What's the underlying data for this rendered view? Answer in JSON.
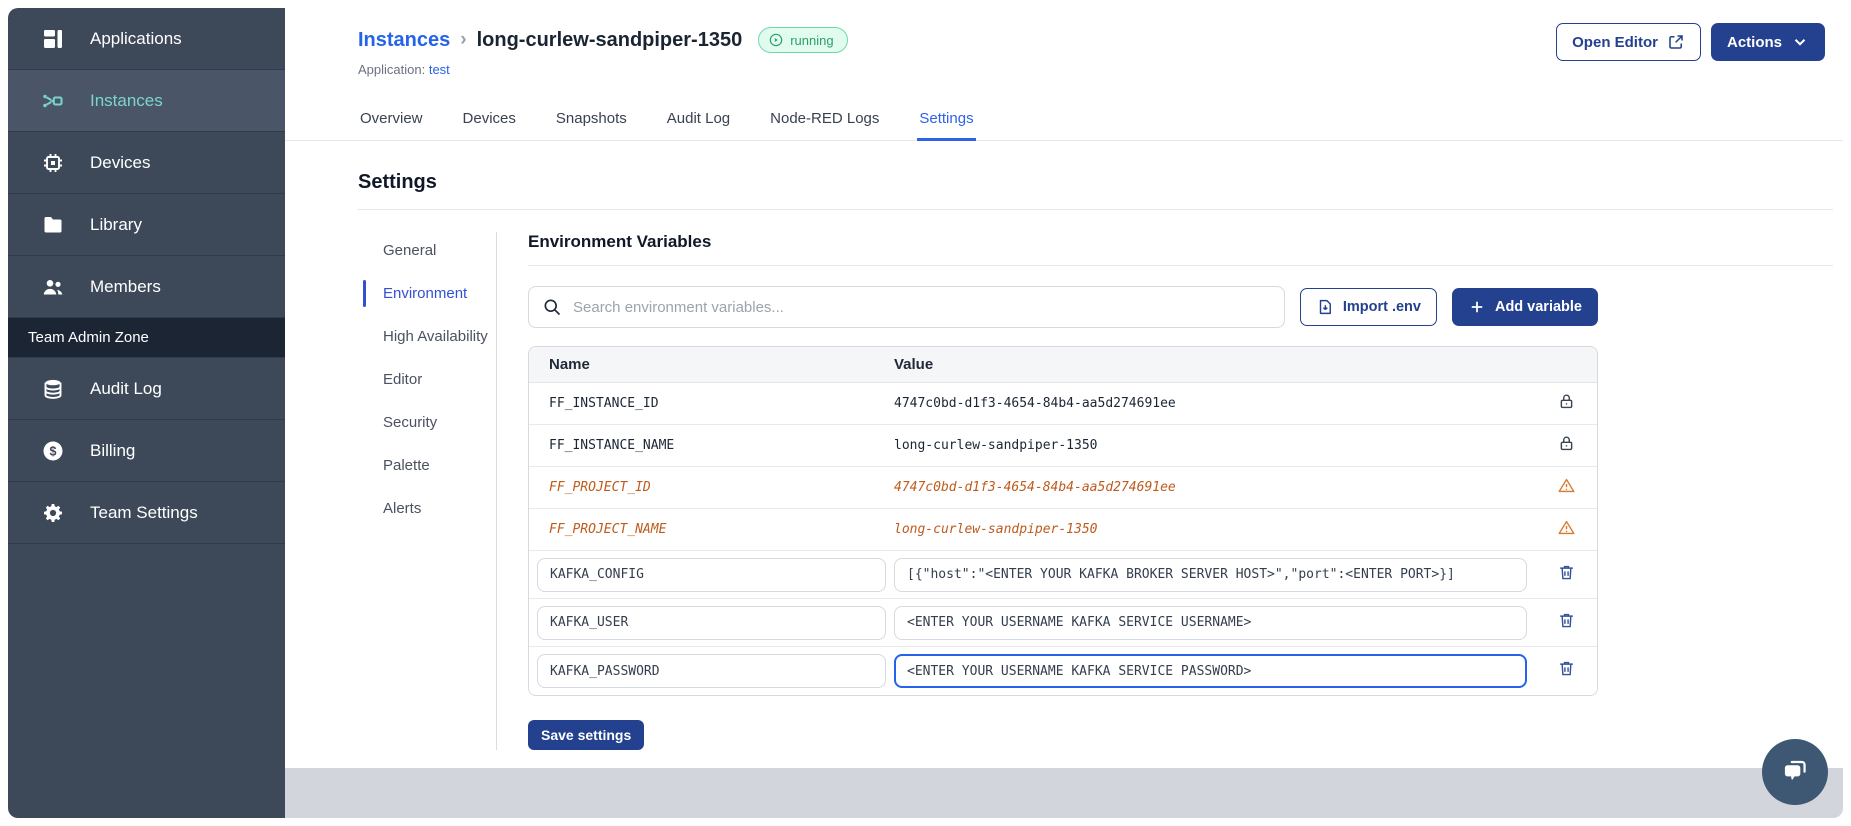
{
  "sidebar": {
    "items": [
      {
        "label": "Applications",
        "icon": "applications",
        "active": false
      },
      {
        "label": "Instances",
        "icon": "instances",
        "active": true
      },
      {
        "label": "Devices",
        "icon": "devices",
        "active": false
      },
      {
        "label": "Library",
        "icon": "library",
        "active": false
      },
      {
        "label": "Members",
        "icon": "members",
        "active": false
      }
    ],
    "section_label": "Team Admin Zone",
    "admin_items": [
      {
        "label": "Audit Log",
        "icon": "audit-log",
        "active": false
      },
      {
        "label": "Billing",
        "icon": "billing",
        "active": false
      },
      {
        "label": "Team Settings",
        "icon": "team-settings",
        "active": false
      }
    ]
  },
  "header": {
    "breadcrumb": "Instances",
    "instance_name": "long-curlew-sandpiper-1350",
    "status": "running",
    "application_label": "Application:",
    "application_name": "test",
    "open_editor_label": "Open Editor",
    "actions_label": "Actions"
  },
  "tabs": {
    "items": [
      "Overview",
      "Devices",
      "Snapshots",
      "Audit Log",
      "Node-RED Logs",
      "Settings"
    ],
    "active": "Settings"
  },
  "settings": {
    "title": "Settings",
    "nav": {
      "items": [
        "General",
        "Environment",
        "High Availability",
        "Editor",
        "Security",
        "Palette",
        "Alerts"
      ],
      "active": "Environment"
    },
    "section_title": "Environment Variables",
    "search_placeholder": "Search environment variables...",
    "import_label": "Import .env",
    "add_label": "Add variable",
    "table": {
      "columns": [
        "Name",
        "Value"
      ],
      "rows": [
        {
          "name": "FF_INSTANCE_ID",
          "value": "4747c0bd-d1f3-4654-84b4-aa5d274691ee",
          "type": "locked"
        },
        {
          "name": "FF_INSTANCE_NAME",
          "value": "long-curlew-sandpiper-1350",
          "type": "locked"
        },
        {
          "name": "FF_PROJECT_ID",
          "value": "4747c0bd-d1f3-4654-84b4-aa5d274691ee",
          "type": "deprecated"
        },
        {
          "name": "FF_PROJECT_NAME",
          "value": "long-curlew-sandpiper-1350",
          "type": "deprecated"
        },
        {
          "name": "KAFKA_CONFIG",
          "value": "[{\"host\":\"<ENTER YOUR KAFKA BROKER SERVER HOST>\",\"port\":<ENTER PORT>}]",
          "type": "editable",
          "focused": false
        },
        {
          "name": "KAFKA_USER",
          "value": "<ENTER YOUR USERNAME KAFKA SERVICE USERNAME>",
          "type": "editable",
          "focused": false
        },
        {
          "name": "KAFKA_PASSWORD",
          "value": "<ENTER YOUR USERNAME KAFKA SERVICE PASSWORD>",
          "type": "editable",
          "focused": true
        }
      ]
    },
    "save_label": "Save settings"
  },
  "colors": {
    "navy": "#24418F",
    "link_blue": "#2563EB",
    "sidebar_teal": "#7AD6CB",
    "sidebar_bg": "#3D4859",
    "deprecated_orange": "#BE5B1D",
    "warning_orange": "#D9792E",
    "badge_green_bg": "#E1FBEE",
    "badge_green_border": "#6ADBA8",
    "badge_green_text": "#2E9E6B",
    "bottom_gray_band": "#D2D5DB",
    "chat_bubble_bg": "#3E5873"
  }
}
